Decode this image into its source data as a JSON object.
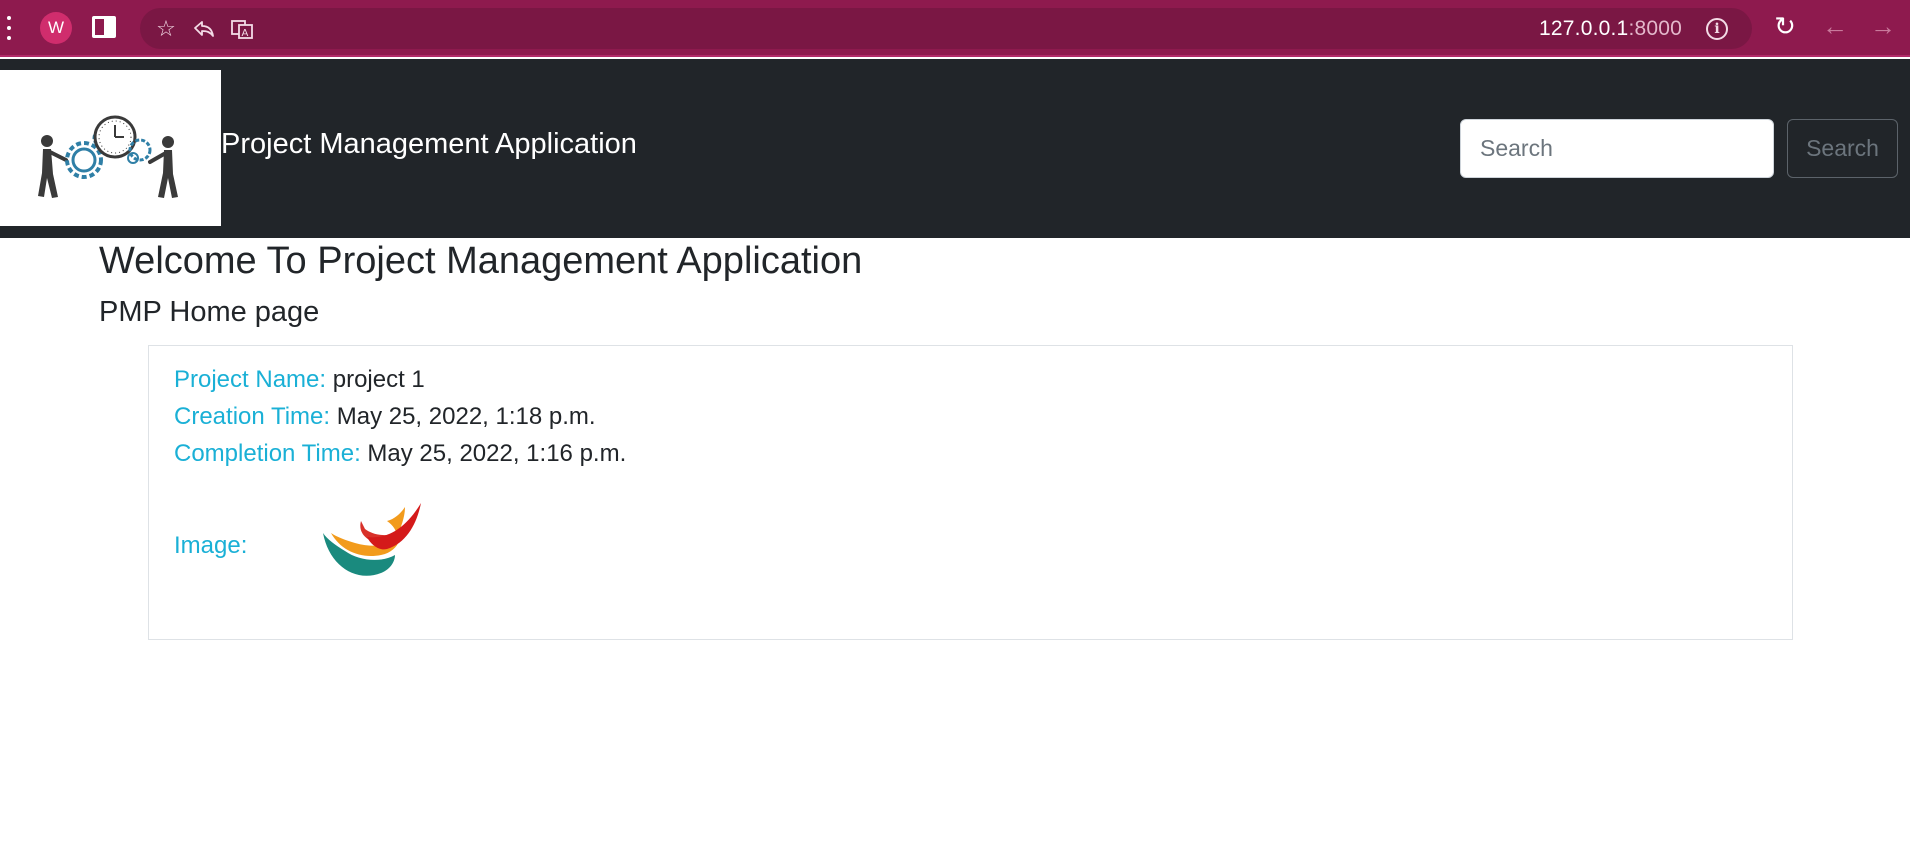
{
  "browser": {
    "profile_initial": "W",
    "url_host": "127.0.0.1",
    "url_port": ":8000",
    "icons": [
      "menu-icon",
      "profile-avatar",
      "sidebar-icon",
      "star-icon",
      "share-icon",
      "translate-icon",
      "info-icon",
      "reload-icon",
      "back-icon",
      "forward-icon"
    ]
  },
  "navbar": {
    "brand": "Project Management Application",
    "search_placeholder": "Search",
    "search_button": "Search"
  },
  "main": {
    "title": "Welcome To Project Management Application",
    "subtitle": "PMP Home page"
  },
  "project": {
    "name_label": "Project Name:",
    "name_value": " project 1",
    "creation_label": "Creation Time:",
    "creation_value": " May 25, 2022, 1:18 p.m.",
    "completion_label": "Completion Time:",
    "completion_value": " May 25, 2022, 1:16 p.m.",
    "image_label": "Image:"
  },
  "colors": {
    "browser_bar": "#8e1a4e",
    "navbar": "#212529",
    "label_accent": "#1ab0d6",
    "text": "#212529"
  }
}
